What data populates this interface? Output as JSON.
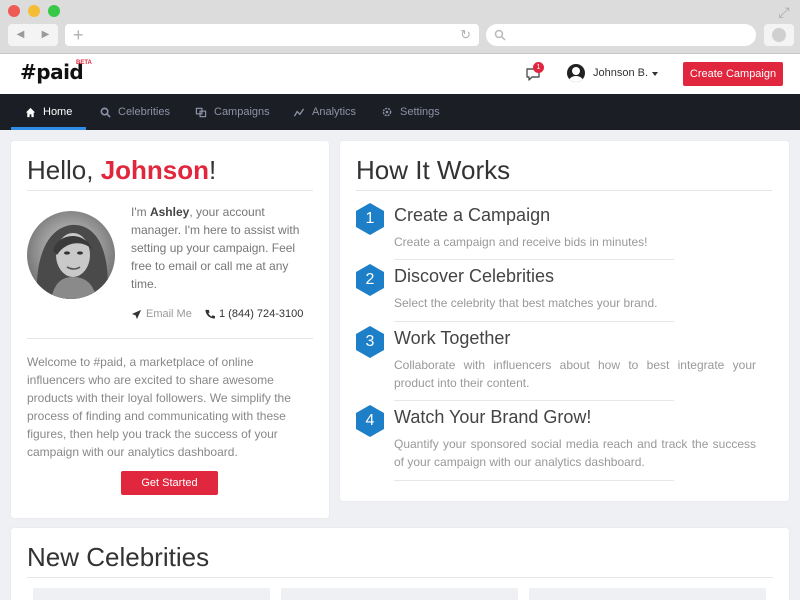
{
  "app": {
    "logo": "#paid",
    "logo_badge": "BETA",
    "notification_count": "1",
    "user_name": "Johnson B.",
    "create_campaign_label": "Create Campaign"
  },
  "colors": {
    "accent": "#e0273d",
    "nav_bg": "#1c1e26",
    "step_blue": "#1c7fc8",
    "active_tab": "#2e8be6"
  },
  "nav": {
    "items": [
      {
        "label": "Home",
        "icon": "home-icon",
        "active": true
      },
      {
        "label": "Celebrities",
        "icon": "search-icon",
        "active": false
      },
      {
        "label": "Campaigns",
        "icon": "campaigns-icon",
        "active": false
      },
      {
        "label": "Analytics",
        "icon": "analytics-icon",
        "active": false
      },
      {
        "label": "Settings",
        "icon": "gear-icon",
        "active": false
      }
    ]
  },
  "hello": {
    "greeting": "Hello, ",
    "name": "Johnson",
    "exclaim": "!",
    "intro_pre": "I'm ",
    "manager_name": "Ashley",
    "intro_post": ", your account manager. I'm here to assist with setting up your campaign. Feel free to email or call me at any time.",
    "email_label": "Email Me",
    "phone": "1 (844) 724-3100",
    "welcome": "Welcome to #paid, a marketplace of online influencers who are excited to share awesome products with their loyal followers. We simplify the process of finding and communicating with these figures, then help you track the success of your campaign with our analytics dashboard.",
    "get_started_label": "Get Started"
  },
  "how": {
    "title": "How It Works",
    "steps": [
      {
        "num": "1",
        "title": "Create a Campaign",
        "desc": "Create a campaign and receive bids in minutes!"
      },
      {
        "num": "2",
        "title": "Discover Celebrities",
        "desc": "Select the celebrity that best matches your brand."
      },
      {
        "num": "3",
        "title": "Work Together",
        "desc": "Collaborate with influencers about how to best integrate your product into their content."
      },
      {
        "num": "4",
        "title": "Watch Your Brand Grow!",
        "desc": "Quantify your sponsored social media reach and track the success of your campaign with our analytics dashboard."
      }
    ]
  },
  "new_celebrities": {
    "title": "New Celebrities"
  }
}
